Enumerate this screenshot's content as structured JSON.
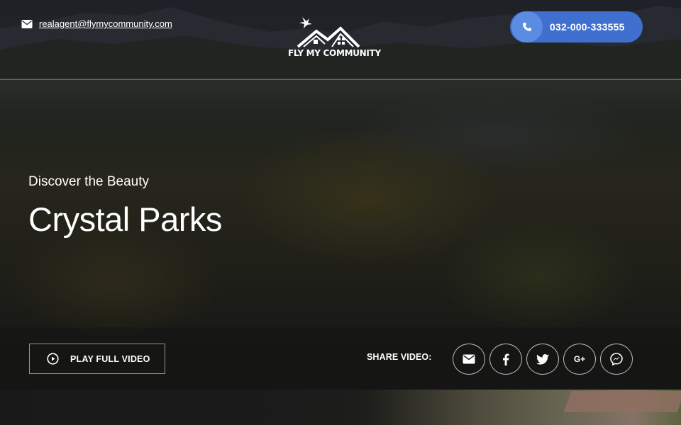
{
  "header": {
    "email": "realagent@flymycommunity.com",
    "logo_text": "FLY MY COMMUNITY",
    "phone": "032-000-333555"
  },
  "hero": {
    "subtitle": "Discover the Beauty",
    "title": "Crystal Parks"
  },
  "controls": {
    "play_label": "PLAY FULL VIDEO",
    "share_label": "SHARE VIDEO:",
    "share_icons": [
      "mail-icon",
      "facebook-icon",
      "twitter-icon",
      "google-plus-icon",
      "messenger-icon"
    ],
    "google_plus_text": "G+"
  },
  "colors": {
    "accent": "#3f6fcf",
    "accent_light": "#5c8be2"
  }
}
